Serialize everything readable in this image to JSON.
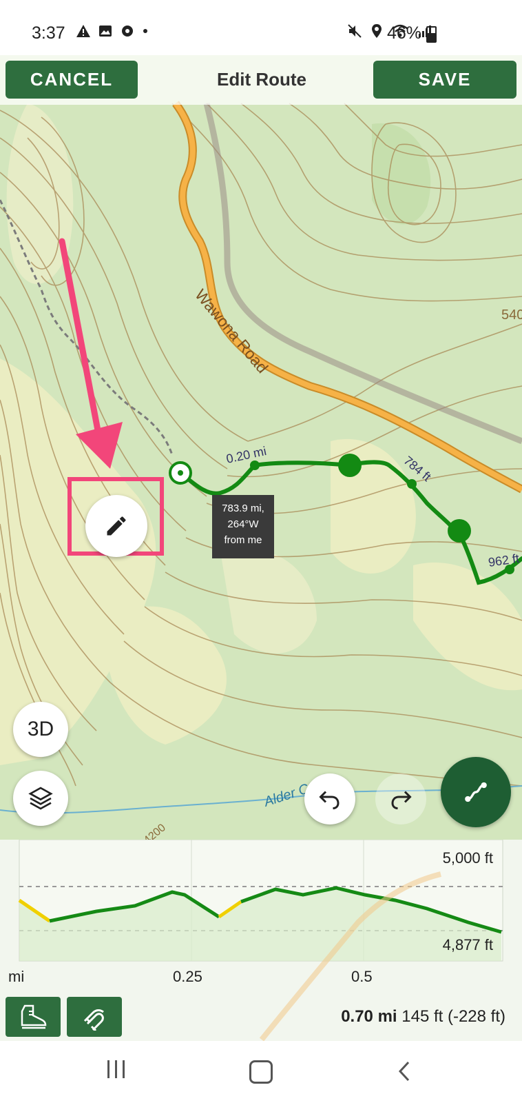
{
  "status_bar": {
    "time": "3:37",
    "battery": "46%",
    "left_icons": [
      "warning-icon",
      "image-icon",
      "gear-icon",
      "dot-icon"
    ],
    "right_icons": [
      "mute-icon",
      "location-icon",
      "wifi-icon",
      "signal-icon"
    ]
  },
  "header": {
    "cancel_label": "CANCEL",
    "title": "Edit Route",
    "save_label": "SAVE"
  },
  "map": {
    "road_label": "Wawona Road",
    "creek_label": "Alder C",
    "contour_label_1": "540",
    "contour_label_2": "4200",
    "segment_labels": [
      "0.20 mi",
      "784 ft",
      "962 ft"
    ],
    "tooltip": {
      "line1": "783.9 mi,",
      "line2": "264°W",
      "line3": "from me"
    },
    "btn_3d": "3D"
  },
  "elevation": {
    "max_label": "5,000 ft",
    "min_label": "4,877 ft",
    "x_unit": "mi",
    "x_ticks": [
      "0.25",
      "0.5"
    ],
    "summary_distance": "0.70 mi",
    "summary_gain": "145 ft (-228 ft)"
  },
  "colors": {
    "accent_green": "#2e6e3e",
    "route_green": "#0f8a0f",
    "highlight_pink": "#f2467a",
    "road_orange": "#f5a623"
  }
}
